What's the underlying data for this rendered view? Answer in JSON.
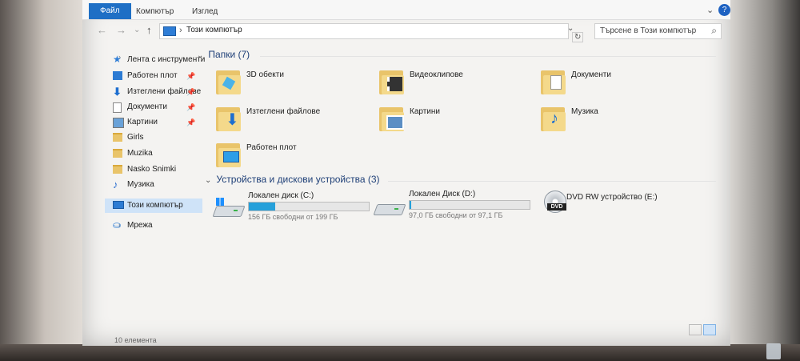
{
  "ribbon": {
    "tabs": [
      "Файл",
      "Компютър",
      "Изглед"
    ],
    "help_label": "?"
  },
  "address": {
    "crumb": "Този компютър",
    "search_placeholder": "Търсене в Този компютър"
  },
  "sidebar": {
    "items": [
      {
        "label": "Лента с инструменти",
        "icon": "star-icon",
        "pinned": false
      },
      {
        "label": "Работен плот",
        "icon": "desktop-icon",
        "pinned": true
      },
      {
        "label": "Изтеглени файлове",
        "icon": "download-icon",
        "pinned": true
      },
      {
        "label": "Документи",
        "icon": "document-icon",
        "pinned": true
      },
      {
        "label": "Картини",
        "icon": "pictures-icon",
        "pinned": true
      },
      {
        "label": "Girls",
        "icon": "folder-icon",
        "pinned": false
      },
      {
        "label": "Muzika",
        "icon": "folder-icon",
        "pinned": false
      },
      {
        "label": "Nasko Snimki",
        "icon": "folder-icon",
        "pinned": false
      },
      {
        "label": "Музика",
        "icon": "music-icon",
        "pinned": false
      },
      {
        "label": "Този компютър",
        "icon": "computer-icon",
        "pinned": false,
        "selected": true
      },
      {
        "label": "Мрежа",
        "icon": "network-icon",
        "pinned": false
      }
    ]
  },
  "folders": {
    "heading": "Папки (7)",
    "items": [
      {
        "label": "3D обекти",
        "icon": "3d-objects-folder-icon"
      },
      {
        "label": "Видеоклипове",
        "icon": "videos-folder-icon"
      },
      {
        "label": "Документи",
        "icon": "documents-folder-icon"
      },
      {
        "label": "Изтеглени файлове",
        "icon": "downloads-folder-icon"
      },
      {
        "label": "Картини",
        "icon": "pictures-folder-icon"
      },
      {
        "label": "Музика",
        "icon": "music-folder-icon"
      },
      {
        "label": "Работен плот",
        "icon": "desktop-folder-icon"
      }
    ]
  },
  "devices": {
    "heading": "Устройства и дискови устройства (3)",
    "items": [
      {
        "name": "Локален диск (C:)",
        "free": "156 ГБ свободни от 199 ГБ",
        "used_fraction": 0.22,
        "icon": "windows-drive-icon"
      },
      {
        "name": "Локален Диск (D:)",
        "free": "97,0 ГБ свободни от 97,1 ГБ",
        "used_fraction": 0.01,
        "icon": "hard-drive-icon"
      },
      {
        "name": "DVD RW устройство (E:)",
        "icon": "dvd-drive-icon",
        "dvd_label": "DVD"
      }
    ]
  },
  "status": {
    "count": "10 елемента"
  },
  "colors": {
    "accent": "#1e6fc5",
    "folder": "#e9c46a",
    "drive_bar": "#26a0da"
  }
}
